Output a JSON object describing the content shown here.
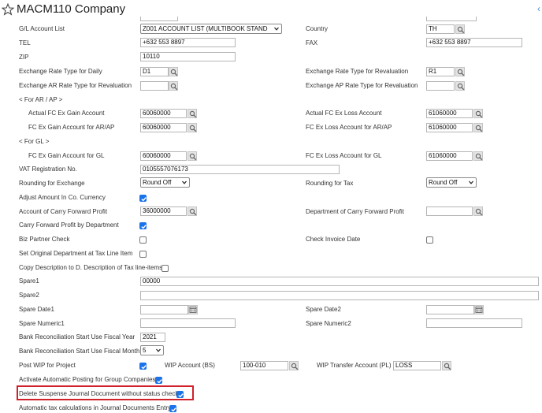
{
  "header": {
    "title": "MACM110 Company"
  },
  "labels": {
    "gl_account_list": "G/L Account List",
    "country": "Country",
    "tel": "TEL",
    "fax": "FAX",
    "zip": "ZIP",
    "rate_daily": "Exchange Rate Type for Daily",
    "rate_reval": "Exchange Rate Type for Revaluation",
    "ar_rate_reval": "Exchange AR Rate Type for Revaluation",
    "ap_rate_reval": "Exchange AP Rate Type for Revaluation",
    "for_ar_ap": "< For AR / AP >",
    "actual_gain": "Actual FC Ex Gain Account",
    "actual_loss": "Actual FC Ex Loss Account",
    "gain_arap": "FC Ex Gain Account for AR/AP",
    "loss_arap": "FC Ex Loss Account for AR/AP",
    "for_gl": "< For GL >",
    "gain_gl": "FC Ex Gain Account for GL",
    "loss_gl": "FC Ex Loss Account for GL",
    "vat_reg": "VAT Registration No.",
    "rounding_exchange": "Rounding for Exchange",
    "rounding_tax": "Rounding for Tax",
    "adjust_amount": "Adjust Amount In Co. Currency",
    "carry_forward_account": "Account of Carry Forward Profit",
    "carry_forward_dept": "Department of Carry Forward Profit",
    "carry_forward_by_dept": "Carry Forward Profit by Department",
    "biz_partner_check": "Biz Partner Check",
    "check_invoice_date": "Check Invoice Date",
    "set_original_dept": "Set Original Department at Tax Line Item",
    "copy_description": "Copy Description to D. Description of Tax line-items",
    "spare1": "Spare1",
    "spare2": "Spare2",
    "spare_date1": "Spare Date1",
    "spare_date2": "Spare Date2",
    "spare_numeric1": "Spare Numeric1",
    "spare_numeric2": "Spare Numeric2",
    "bank_fiscal_year": "Bank Reconciliation Start Use Fiscal Year",
    "bank_fiscal_month": "Bank Reconciliation Start Use Fiscal Month",
    "post_wip": "Post WIP for Project",
    "wip_account_bs": "WIP Account (BS)",
    "wip_transfer_pl": "WIP Transfer Account (PL)",
    "activate_auto_posting": "Activate Automatic Posting for Group Companies",
    "delete_suspense": "Delete Suspense Journal Document without status check",
    "auto_tax_calc": "Automatic tax calculations in Journal Documents Entry"
  },
  "values": {
    "gl_account_list": "Z001 ACCOUNT LIST (MULTIBOOK STAND",
    "country": "TH",
    "tel": "+632 553 8897",
    "fax": "+632 553 8897",
    "zip": "10110",
    "rate_daily": "D1",
    "rate_reval": "R1",
    "ar_rate_reval": "",
    "ap_rate_reval": "",
    "actual_gain": "60060000",
    "actual_loss": "61060000",
    "gain_arap": "60060000",
    "loss_arap": "61060000",
    "gain_gl": "60060000",
    "loss_gl": "61060000",
    "vat_reg": "0105557076173",
    "rounding_exchange": "Round Off",
    "rounding_tax": "Round Off",
    "carry_forward_account": "36000000",
    "carry_forward_dept": "",
    "spare1": "00000",
    "spare2": "",
    "spare_date1": "",
    "spare_date2": "",
    "spare_numeric1": "",
    "spare_numeric2": "",
    "bank_fiscal_year": "2021",
    "bank_fiscal_month": "5",
    "wip_account_bs": "100-010",
    "wip_transfer_pl": "LOSS"
  },
  "checks": {
    "adjust_amount": true,
    "carry_forward_by_dept": true,
    "biz_partner_check": false,
    "check_invoice_date": false,
    "set_original_dept": false,
    "copy_description": false,
    "post_wip": true,
    "activate_auto_posting": true,
    "delete_suspense": true,
    "auto_tax_calc": true
  },
  "icons": {
    "star": "star-icon",
    "search": "search-icon",
    "calendar": "calendar-icon",
    "chevron": "chevron-down-icon"
  },
  "colors": {
    "checkbox": "#1a73e8",
    "highlight": "#d0202a",
    "edge": "#4a90d9"
  }
}
